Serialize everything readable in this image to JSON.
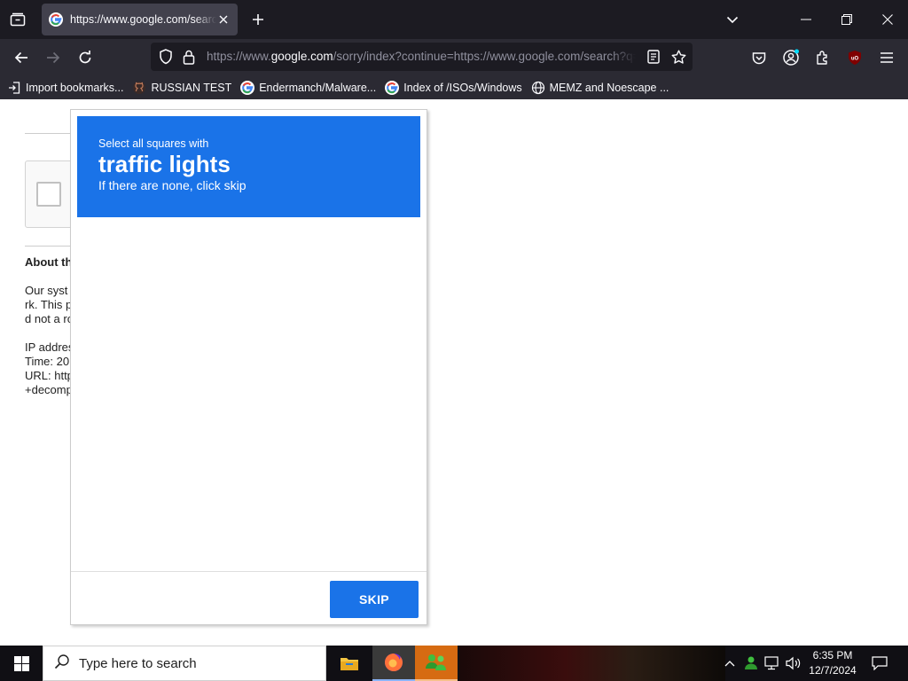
{
  "browser": {
    "tab": {
      "title": "https://www.google.com/search?"
    },
    "url": {
      "prefix": "https://www.",
      "domain": "google.com",
      "path": "/sorry/index?continue=https://www.google.com/search?q=..."
    },
    "bookmarks": [
      {
        "label": "Import bookmarks...",
        "icon": "import-icon"
      },
      {
        "label": "RUSSIAN TEST",
        "icon": "github-icon"
      },
      {
        "label": "Endermanch/Malware...",
        "icon": "google-icon"
      },
      {
        "label": "Index of /ISOs/Windows",
        "icon": "google-icon"
      },
      {
        "label": "MEMZ and Noescape ...",
        "icon": "globe-icon"
      }
    ],
    "colors": {
      "toolbar": "#2b2a33",
      "tabbar": "#1c1b22"
    }
  },
  "page": {
    "about_heading": "About th",
    "lines": [
      "Our syst",
      "rk. This p",
      "d not a ro",
      "",
      "IP addres",
      "Time: 20",
      "URL: http",
      "+decomp"
    ]
  },
  "challenge": {
    "instruction": "Select all squares with",
    "target": "traffic lights",
    "subtext": "If there are none, click skip",
    "skip_label": "SKIP",
    "accent_color": "#1a73e8"
  },
  "taskbar": {
    "search_placeholder": "Type here to search",
    "time": "6:35 PM",
    "date": "12/7/2024",
    "apps": [
      "file-explorer",
      "firefox",
      "app-green-people"
    ]
  }
}
